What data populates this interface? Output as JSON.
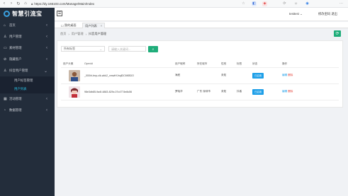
{
  "browser": {
    "url": "https://dy.165103.com/Manage/Main/Index",
    "nav_icons": [
      "back-icon",
      "forward-icon",
      "reload-icon",
      "home-icon",
      "lock-icon"
    ],
    "extensions": [
      "star-icon",
      "extension-icon",
      "puzzle-icon",
      "sync-icon",
      "profile-icon",
      "more-icon"
    ]
  },
  "sidebar": {
    "logo_text": "智慧引流宝",
    "items": [
      {
        "label": "首页",
        "icon": "home-icon"
      },
      {
        "label": "用户管理",
        "icon": "user-icon"
      },
      {
        "label": "素材管理",
        "icon": "folder-icon"
      },
      {
        "label": "隐藏客户",
        "icon": "eye-off-icon"
      },
      {
        "label": "抖音用户管理",
        "icon": "user-group-icon"
      }
    ],
    "submenu": [
      {
        "label": "用户标签管理"
      },
      {
        "label": "用户列表",
        "active": true
      }
    ],
    "items_after": [
      {
        "label": "活动管理",
        "icon": "calendar-icon"
      },
      {
        "label": "数据管理",
        "icon": "chart-icon"
      }
    ]
  },
  "topbar": {
    "menu_icon": "☰",
    "user": "testtest",
    "change_password": "修改密码 退出"
  },
  "tabs": [
    {
      "label": "我的桌面",
      "icon": "☐"
    },
    {
      "label": "用户列表",
      "close": "×"
    }
  ],
  "breadcrumb": {
    "home": "首页",
    "sep": "›",
    "level2": "用户管理",
    "current": "抖音用户管理"
  },
  "filter": {
    "select_value": "所有标签",
    "search_placeholder": "请输入关键词..."
  },
  "table": {
    "headers": [
      "用户头像",
      "OpenId",
      "用户昵称",
      "所在城市",
      "性别",
      "标签",
      "状态",
      "操作"
    ],
    "rows": [
      {
        "openid": "_000irl-tmp-clk-wkk2_xmwtHJnqlDC6KBDO",
        "nickname": "海底",
        "city": "",
        "gender": "未知",
        "tag": "",
        "status": "已启用",
        "op1": "编辑",
        "op2": "删除"
      },
      {
        "openid": "98e3db85-9a4f-4883-829c-07c4774e8c56",
        "nickname": "罗晓华",
        "city": "广东 深圳市",
        "gender": "未知",
        "tag": "抖客",
        "status": "已启用",
        "op1": "编辑",
        "op2": "删除"
      }
    ]
  },
  "colors": {
    "sidebar_bg": "#232d3b",
    "accent_green": "#1fad7a",
    "status_blue": "#1e9fe8",
    "delete_red": "#e5463d",
    "active_submenu": "#29c6ea"
  }
}
